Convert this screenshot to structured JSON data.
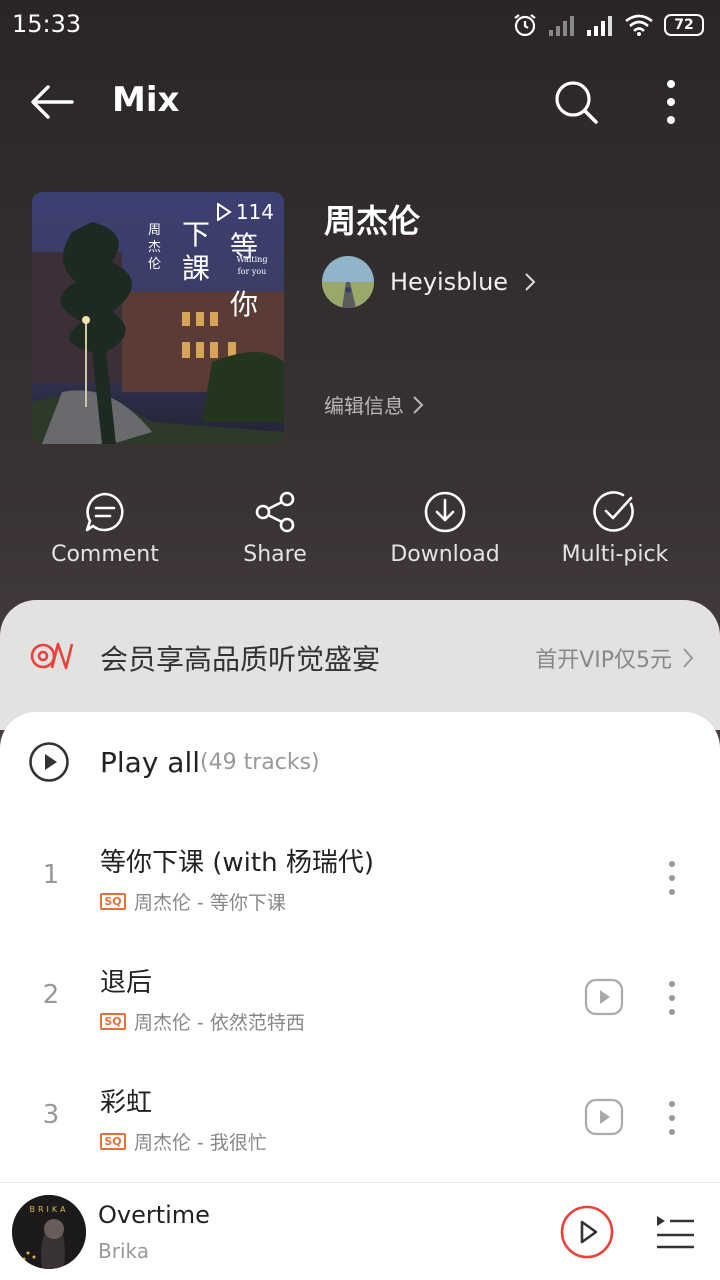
{
  "status_bar": {
    "time": "15:33",
    "battery": "72"
  },
  "header": {
    "title": "Mix"
  },
  "playlist": {
    "cover_play_count": "114",
    "cover_text_artist": "周杰伦",
    "cover_text_title1": "下課",
    "cover_text_title2": "等你",
    "cover_text_subtitle": "Waiting for you",
    "name": "周杰伦",
    "creator": "Heyisblue",
    "edit_info": "编辑信息"
  },
  "actions": [
    {
      "label": "Comment",
      "icon": "comment-icon"
    },
    {
      "label": "Share",
      "icon": "share-icon"
    },
    {
      "label": "Download",
      "icon": "download-icon"
    },
    {
      "label": "Multi-pick",
      "icon": "multi-pick-icon"
    }
  ],
  "vip_banner": {
    "text": "会员享高品质听觉盛宴",
    "cta": "首开VIP仅5元",
    "accent": "#e8433a"
  },
  "play_all": {
    "label": "Play all",
    "count": "(49 tracks)"
  },
  "tracks": [
    {
      "index": "1",
      "title": "等你下课 (with 杨瑞代)",
      "quality": "SQ",
      "meta": "周杰伦 - 等你下课",
      "has_mv": false
    },
    {
      "index": "2",
      "title": "退后",
      "quality": "SQ",
      "meta": "周杰伦 - 依然范特西",
      "has_mv": true
    },
    {
      "index": "3",
      "title": "彩虹",
      "quality": "SQ",
      "meta": "周杰伦 - 我很忙",
      "has_mv": true
    }
  ],
  "now_playing": {
    "title": "Overtime",
    "artist": "Brika",
    "art_text": "BRIKA"
  },
  "colors": {
    "accent_red": "#e8433a",
    "sq_orange": "#e66f3c"
  }
}
